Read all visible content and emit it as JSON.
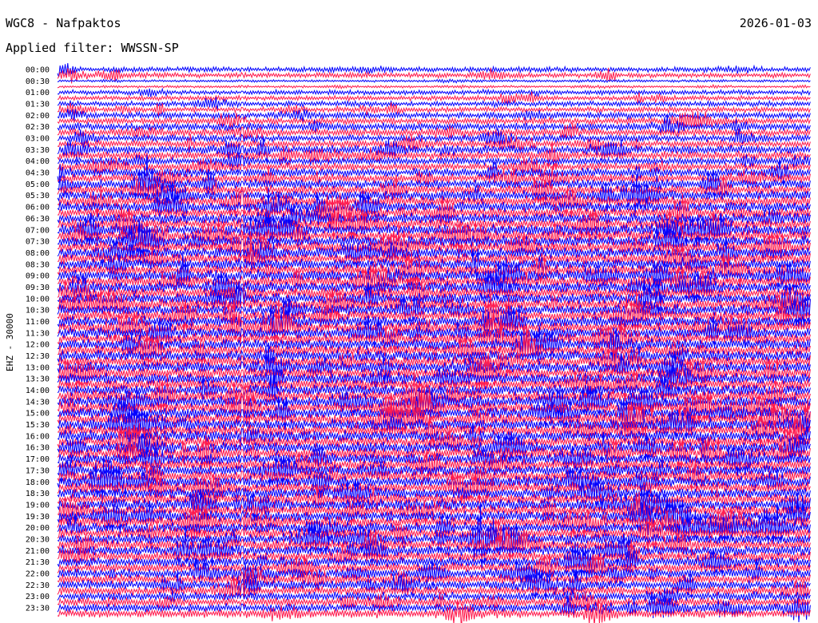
{
  "header": {
    "station": "WGC8 - Nafpaktos",
    "date": "2026-01-03",
    "filter": "Applied filter: WWSSN-SP",
    "channel": "EHZ - 30000"
  },
  "chart_data": {
    "type": "line",
    "y_ticks": [
      "00:00",
      "00:30",
      "01:00",
      "01:30",
      "02:00",
      "02:30",
      "03:00",
      "03:30",
      "04:00",
      "04:30",
      "05:00",
      "05:30",
      "06:00",
      "06:30",
      "07:00",
      "07:30",
      "08:00",
      "08:30",
      "09:00",
      "09:30",
      "10:00",
      "10:30",
      "11:00",
      "11:30",
      "12:00",
      "12:30",
      "13:00",
      "13:30",
      "14:00",
      "14:30",
      "15:00",
      "15:30",
      "16:00",
      "16:30",
      "17:00",
      "17:30",
      "18:00",
      "18:30",
      "19:00",
      "19:30",
      "20:00",
      "20:30",
      "21:00",
      "21:30",
      "22:00",
      "22:30",
      "23:00",
      "23:30"
    ],
    "traces_per_label": 2,
    "series_colors": [
      "#0000ff",
      "#ff1a4d"
    ],
    "amplitude_levels": [
      0.35,
      0.05,
      0.3,
      0.35,
      0.5,
      0.6,
      0.55,
      0.7,
      0.6,
      0.75,
      0.8,
      0.9,
      0.95,
      0.95,
      1.0,
      1.0,
      1.0,
      1.0,
      1.0,
      1.0,
      1.0,
      1.0,
      1.0,
      1.0,
      1.0,
      1.0,
      1.0,
      1.0,
      1.0,
      1.0,
      1.0,
      1.0,
      1.0,
      1.0,
      1.0,
      1.0,
      1.0,
      1.0,
      1.0,
      1.0,
      0.95,
      0.95,
      0.9,
      0.85,
      0.8,
      0.75,
      0.7,
      0.7
    ],
    "grid": false
  }
}
